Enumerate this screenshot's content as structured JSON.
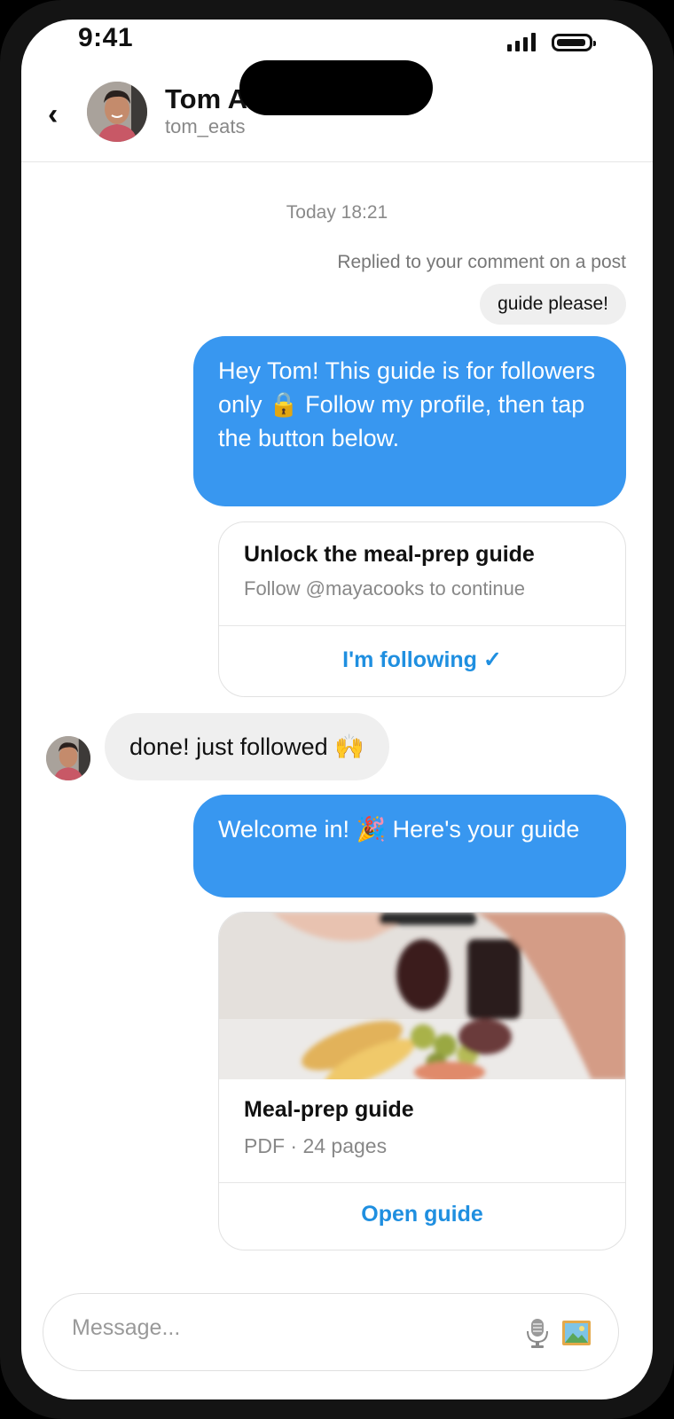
{
  "status_bar": {
    "time": "9:41"
  },
  "header": {
    "name": "Tom A",
    "handle": "tom_eats"
  },
  "thread": {
    "timestamp": "Today 18:21",
    "reply_note": "Replied to your comment on a post",
    "quoted_comment": "guide please!",
    "message_1": "Hey Tom! This guide is for followers only 🔒 Follow my profile, then tap the button below.",
    "unlock_card": {
      "title": "Unlock the meal-prep guide",
      "subtitle": "Follow @mayacooks to continue",
      "button": "I'm following ✓"
    },
    "reply_1": "done! just followed 🙌",
    "message_2": "Welcome in! 🎉 Here's your guide",
    "guide_card": {
      "title": "Meal-prep guide",
      "subtitle": "PDF · 24 pages",
      "button": "Open guide"
    }
  },
  "composer": {
    "placeholder": "Message..."
  },
  "icons": {
    "back": "chevron-left-icon",
    "mic": "microphone-icon",
    "gallery": "image-icon",
    "lock": "lock-icon"
  },
  "colors": {
    "outgoing_bubble": "#3897f0",
    "incoming_bubble": "#efefef",
    "link_button": "#1f8fe0"
  }
}
